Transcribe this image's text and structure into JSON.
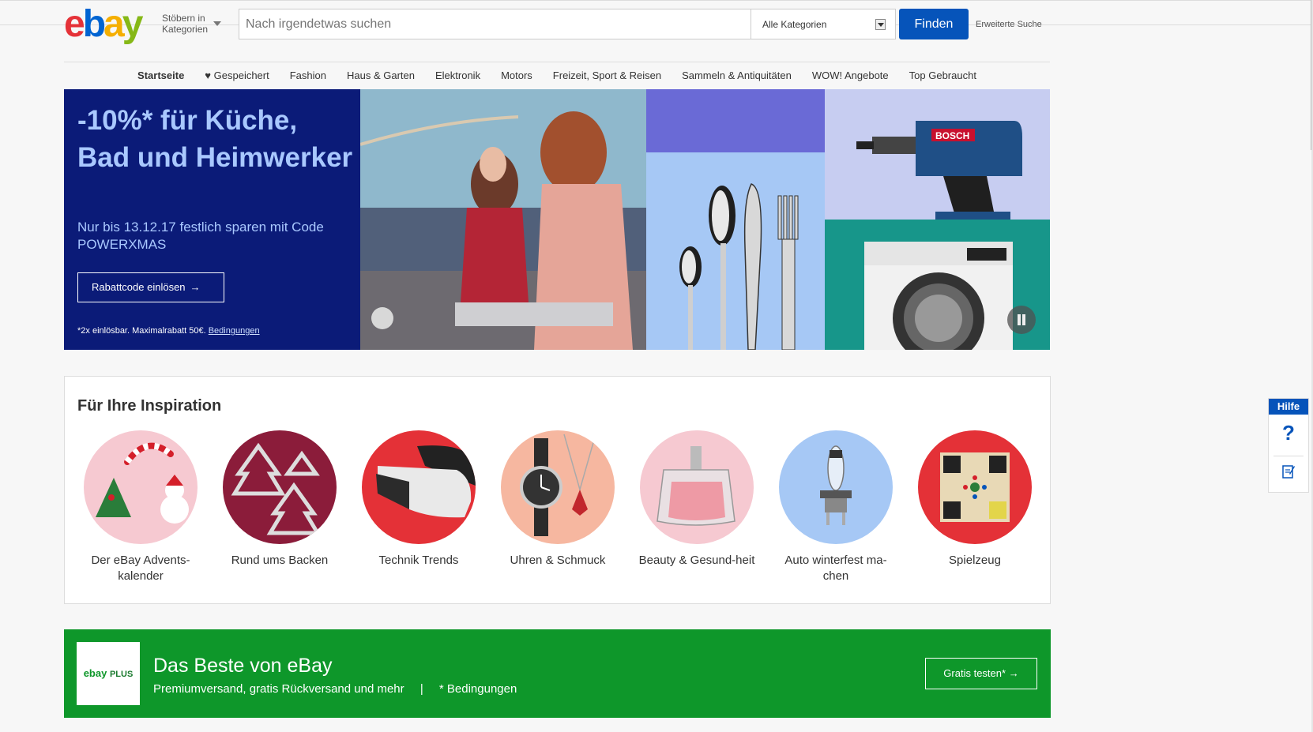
{
  "header": {
    "logo": [
      "e",
      "b",
      "a",
      "y"
    ],
    "logo_colors": [
      "#e53238",
      "#0064d2",
      "#f5af02",
      "#86b817"
    ],
    "shop_by_category": [
      "Stöbern in",
      "Kategorien"
    ],
    "search_placeholder": "Nach irgendetwas suchen",
    "category_select": "Alle Kategorien",
    "find_button": "Finden",
    "advanced_search": "Erweiterte Suche"
  },
  "nav": {
    "items": [
      "Startseite",
      "Gespeichert",
      "Fashion",
      "Haus & Garten",
      "Elektronik",
      "Motors",
      "Freizeit, Sport & Reisen",
      "Sammeln & Antiquitäten",
      "WOW! Angebote",
      "Top Gebraucht"
    ],
    "active": "Startseite"
  },
  "hero": {
    "title": "-10%* für Küche, Bad und Heimwerker",
    "subtitle": "Nur bis 13.12.17 festlich sparen mit Code POWERXMAS",
    "button": "Rabattcode einlösen",
    "button_arrow": "→",
    "fine_print": "*2x einlösbar. Maximalrabatt 50€.",
    "fine_print_link": "Bedingungen",
    "drill_brand": "BOSCH"
  },
  "inspiration": {
    "title": "Für Ihre Inspiration",
    "items": [
      {
        "label": "Der eBay Advents-kalender",
        "icon": "advent-calendar-icon",
        "bg": "#f6c9d1"
      },
      {
        "label": "Rund ums Backen",
        "icon": "cookie-cutters-icon",
        "bg": "#8b1c3a"
      },
      {
        "label": "Technik Trends",
        "icon": "vr-headset-icon",
        "bg": "#e43137"
      },
      {
        "label": "Uhren & Schmuck",
        "icon": "watch-icon",
        "bg": "#f6b7a0"
      },
      {
        "label": "Beauty & Gesund-heit",
        "icon": "perfume-icon",
        "bg": "#f6c9d1"
      },
      {
        "label": "Auto winterfest ma-chen",
        "icon": "bulb-icon",
        "bg": "#a6c8f5"
      },
      {
        "label": "Spielzeug",
        "icon": "board-game-icon",
        "bg": "#e43137"
      }
    ]
  },
  "plus": {
    "logo_a": "ebay",
    "logo_b": "PLUS",
    "title": "Das Beste von eBay",
    "subtitle": "Premiumversand, gratis Rückversand und mehr",
    "separator": "|",
    "conditions": "* Bedingungen",
    "button": "Gratis testen*",
    "button_arrow": "→"
  },
  "help": {
    "label": "Hilfe",
    "question": "?"
  }
}
